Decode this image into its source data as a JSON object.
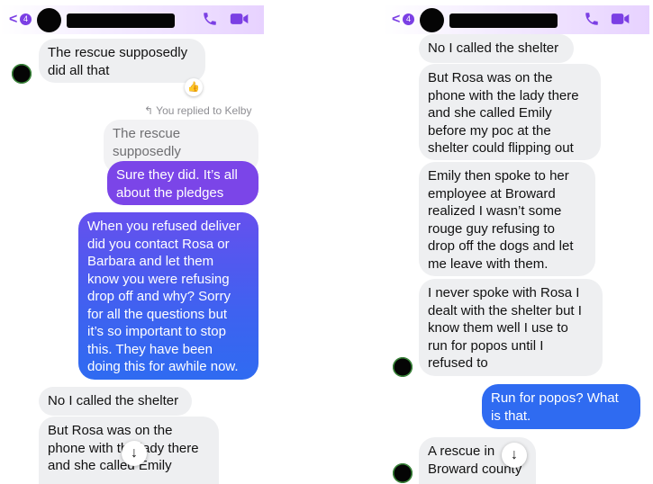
{
  "left": {
    "header": {
      "badge_count": "4",
      "back_glyph": "<"
    },
    "messages": [
      {
        "text": "The rescue supposedly\ndid all that",
        "reaction": "👍"
      },
      {
        "reply_note": "You replied to Kelby",
        "quoted": "The rescue supposedly\ndid all that"
      },
      {
        "text": "Sure they did.  It’s all\nabout the pledges"
      },
      {
        "text": "When you refused deliver\ndid you contact Rosa or\nBarbara and let them\nknow you were refusing\ndrop off and why?  Sorry\nfor all the questions but\nit’s so important to stop\nthis.  They have been\ndoing this for awhile now."
      },
      {
        "text": "No I called the shelter"
      },
      {
        "text": "But Rosa was on the\nphone with the lady there\nand she called Emily"
      }
    ],
    "scroll_glyph": "↓"
  },
  "right": {
    "header": {
      "badge_count": "4",
      "back_glyph": "<"
    },
    "messages": [
      {
        "text": "No I called the shelter"
      },
      {
        "text": "But Rosa was on the\nphone with the lady there\nand she called Emily\nbefore my poc at the\nshelter could flipping out"
      },
      {
        "text": "Emily then spoke to her\nemployee at Broward\nrealized I wasn’t some\nrouge guy refusing to\ndrop off the dogs and let\nme leave with them."
      },
      {
        "text": "I never spoke with Rosa I\ndealt with the shelter but I\nknow them well I use to\nrun for popos until I\nrefused to"
      },
      {
        "text": "Run for popos?  What\nis that."
      },
      {
        "text": "A rescue in\nBroward county"
      }
    ],
    "scroll_glyph": "↓"
  },
  "colors": {
    "accent": "#7b3fe4",
    "incoming_bubble": "#eeeff1",
    "outgoing_purple": "#7b45e8",
    "outgoing_blue": "#2f6bf1"
  }
}
